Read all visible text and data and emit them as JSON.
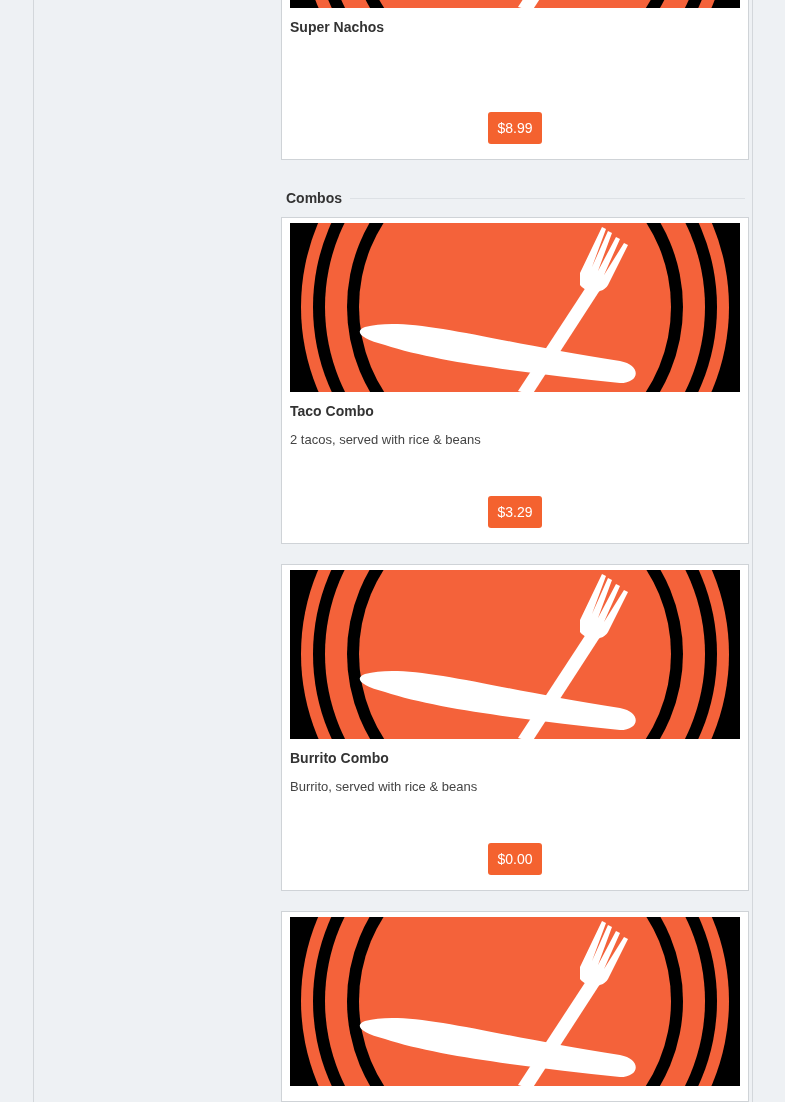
{
  "sections": [
    {
      "items": [
        {
          "image": {
            "kind": "picture"
          },
          "title": "Super Nachos",
          "price": "$8.99"
        }
      ]
    },
    {
      "heading": "Combos",
      "items": [
        {
          "image": {
            "kind": "picture"
          },
          "title": "Taco Combo",
          "description": "2 tacos, served with rice & beans",
          "price": "$3.29"
        },
        {
          "image": {
            "kind": "picture"
          },
          "title": "Burrito Combo",
          "description": "Burrito, served with rice & beans",
          "price": "$0.00"
        },
        {
          "image": {
            "kind": "picture"
          }
        }
      ]
    }
  ]
}
